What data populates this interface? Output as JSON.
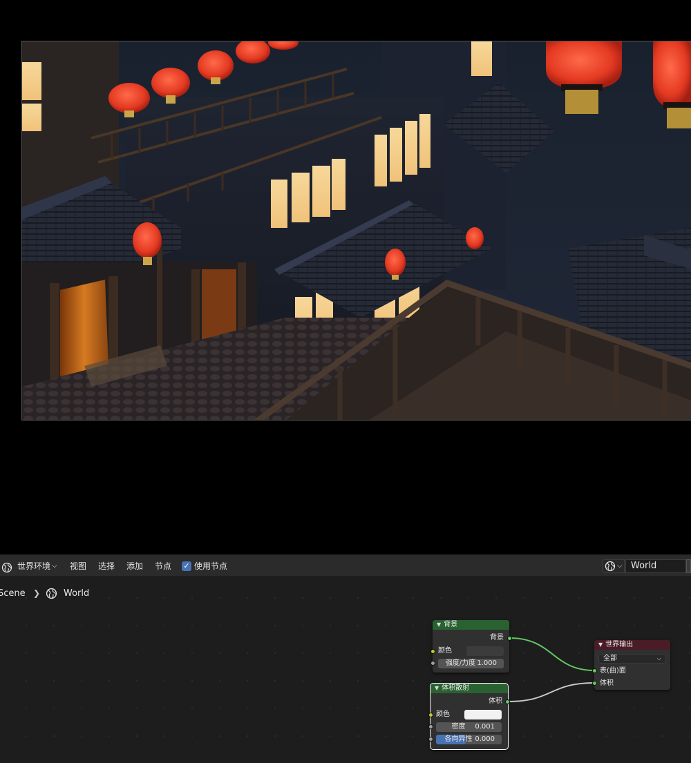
{
  "header": {
    "editor_type_label": "世界环境",
    "menus": [
      "视图",
      "选择",
      "添加",
      "节点"
    ],
    "use_nodes_label": "使用节点",
    "use_nodes_checked": true,
    "world_name": "World"
  },
  "breadcrumb": {
    "scene": "Scene",
    "world": "World"
  },
  "nodes": {
    "background": {
      "title": "背景",
      "output": "背景",
      "color_label": "颜色",
      "color_value": "#1a1a1a",
      "strength_label": "强度/力度",
      "strength_value": "1.000"
    },
    "volume": {
      "title": "体积散射",
      "output": "体积",
      "color_label": "颜色",
      "color_value": "#f2f2f2",
      "density_label": "密度",
      "density_value": "0.001",
      "anisotropy_label": "各向异性",
      "anisotropy_value": "0.000"
    },
    "world_output": {
      "title": "世界输出",
      "target": "全部",
      "surface_label": "表(曲)面",
      "volume_label": "体积"
    }
  },
  "colors": {
    "shader_header": "#2a6131",
    "output_header": "#4a1c27",
    "link_green": "#63c763",
    "link_grey": "#c8c8c8",
    "accent": "#4772b3"
  },
  "icons": [
    "globe-icon",
    "chevron-down-icon",
    "chevron-right-icon",
    "checkbox-icon",
    "shield-icon"
  ]
}
